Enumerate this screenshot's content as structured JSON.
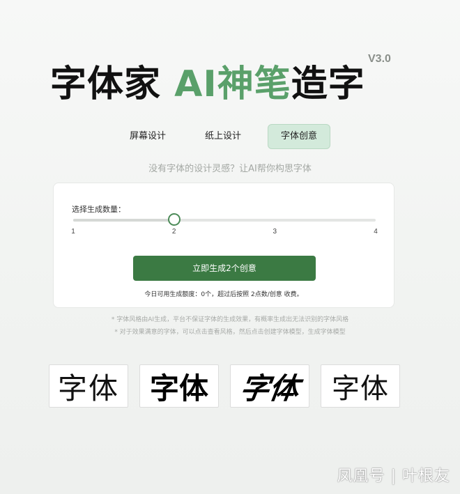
{
  "header": {
    "title_part1": "字体家 ",
    "title_part2": "AI神笔",
    "title_part3": "造字",
    "version": "V3.0"
  },
  "tabs": [
    {
      "label": "屏幕设计",
      "active": false
    },
    {
      "label": "纸上设计",
      "active": false
    },
    {
      "label": "字体创意",
      "active": true
    }
  ],
  "subtitle": "没有字体的设计灵感？让AI帮你构思字体",
  "generator": {
    "slider_label": "选择生成数量：",
    "ticks": [
      "1",
      "2",
      "3",
      "4"
    ],
    "min": 1,
    "max": 4,
    "value": 2,
    "button_label": "立即生成2个创意",
    "quota_text": "今日可用生成额度：0个，超过后按照 2点数/创意 收费。"
  },
  "notes": [
    "* 字体风格由AI生成，平台不保证字体的生成效果，有概率生成出无法识别的字体风格",
    "* 对于效果满意的字体，可以点击查看风格，然后点击创建字体模型，生成字体模型"
  ],
  "samples": [
    {
      "text": "字体"
    },
    {
      "text": "字体"
    },
    {
      "text": "字体"
    },
    {
      "text": "字体"
    }
  ],
  "watermark": "凤凰号 | 叶根友",
  "colors": {
    "accent_green": "#5aa06a",
    "button_green": "#3b7a43",
    "active_tab_bg": "#d3eadb"
  }
}
